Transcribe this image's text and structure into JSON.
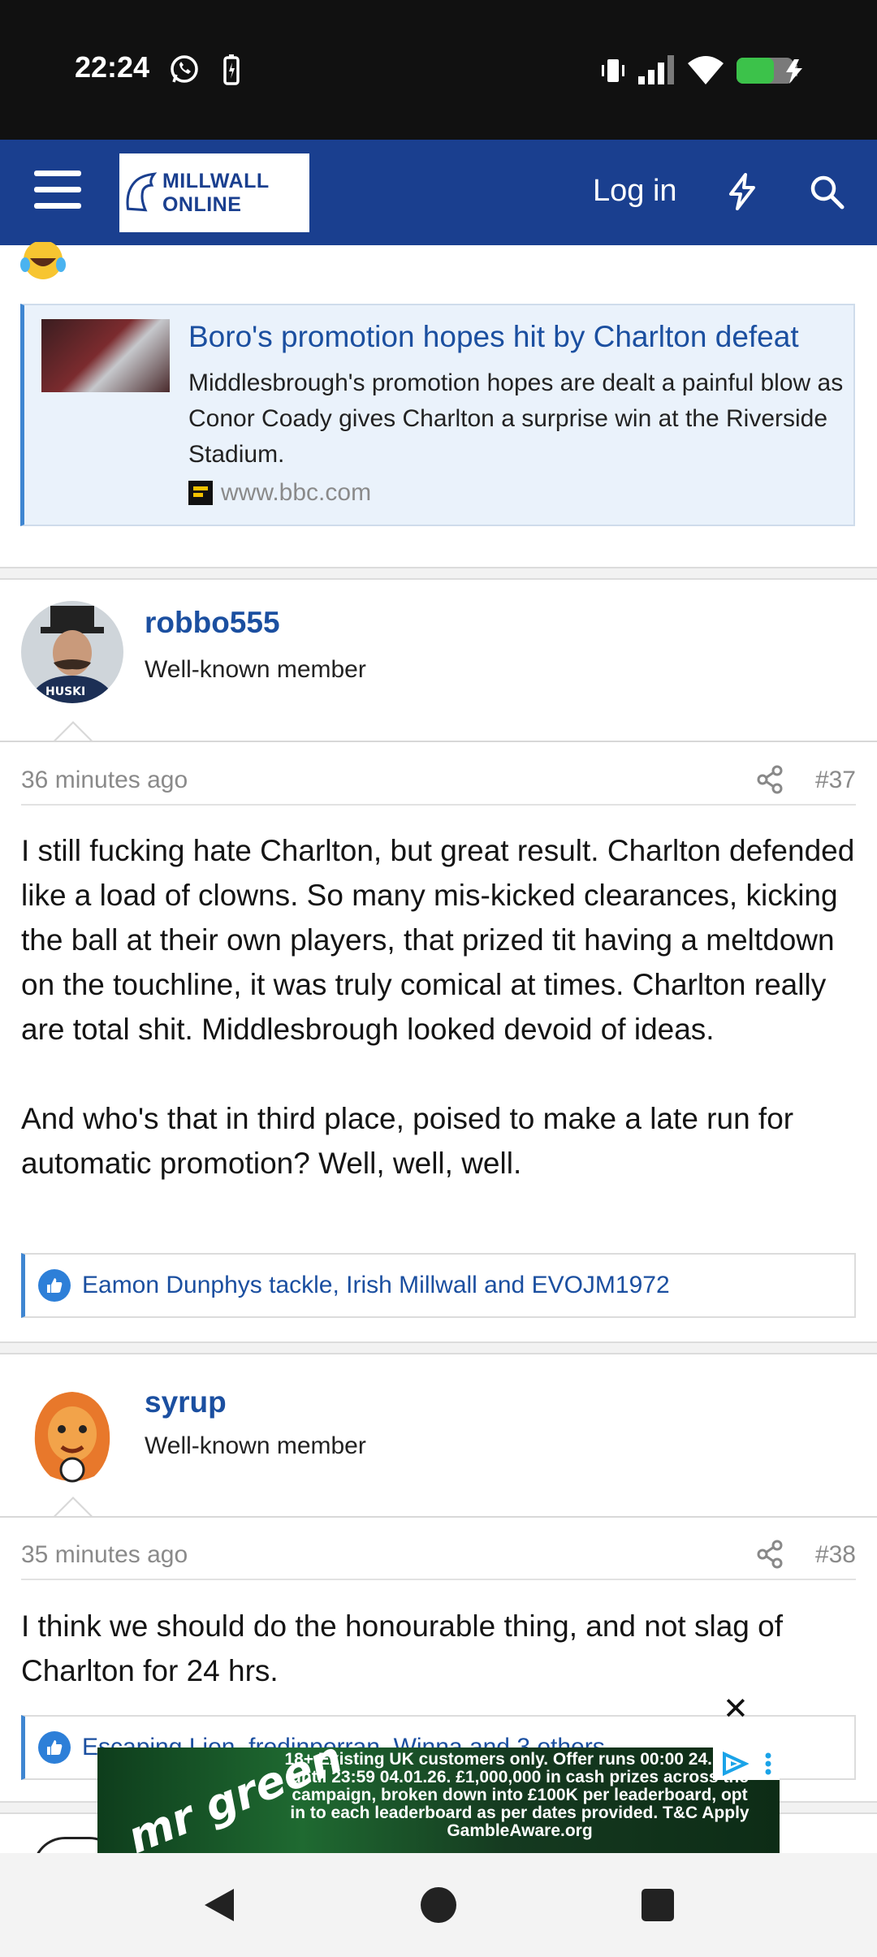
{
  "status_bar": {
    "time": "22:24"
  },
  "header": {
    "logo_text": "MILLWALL ONLINE",
    "login_label": "Log in"
  },
  "link_preview": {
    "title": "Boro's promotion hopes hit by Charlton defeat",
    "description": "Middlesbrough's promotion hopes are dealt a painful blow as Conor Coady gives Charlton a surprise win at the Riverside Stadium.",
    "source": "www.bbc.com"
  },
  "posts": [
    {
      "username": "robbo555",
      "user_title": "Well-known member",
      "time": "36 minutes ago",
      "number": "#37",
      "body": [
        "I still fucking hate Charlton, but great result. Charlton defended like a load of clowns. So many mis-kicked clearances, kicking the ball at their own players, that prized tit having a meltdown on the touchline, it was truly comical at times. Charlton really are total shit. Middlesbrough looked devoid of ideas.",
        "And who's that in third place, poised to make a late run for automatic promotion? Well, well, well."
      ],
      "reactions": "Eamon Dunphys tackle, Irish Millwall and EVOJM1972"
    },
    {
      "username": "syrup",
      "user_title": "Well-known member",
      "time": "35 minutes ago",
      "number": "#38",
      "body": [
        "I think we should do the honourable thing, and not slag of Charlton for 24 hrs."
      ],
      "reactions": "Escaping Lion, fredinperran, Winna and 3 others"
    }
  ],
  "ad": {
    "brand": "mr green",
    "text": "18+ Existing UK customers only. Offer runs 00:00 24.10.25 until 23:59 04.01.26. £1,000,000 in cash prizes across the campaign, broken down into £100K per leaderboard, opt in to each leaderboard as per dates provided. T&C Apply GambleAware.org",
    "close": "✕"
  }
}
